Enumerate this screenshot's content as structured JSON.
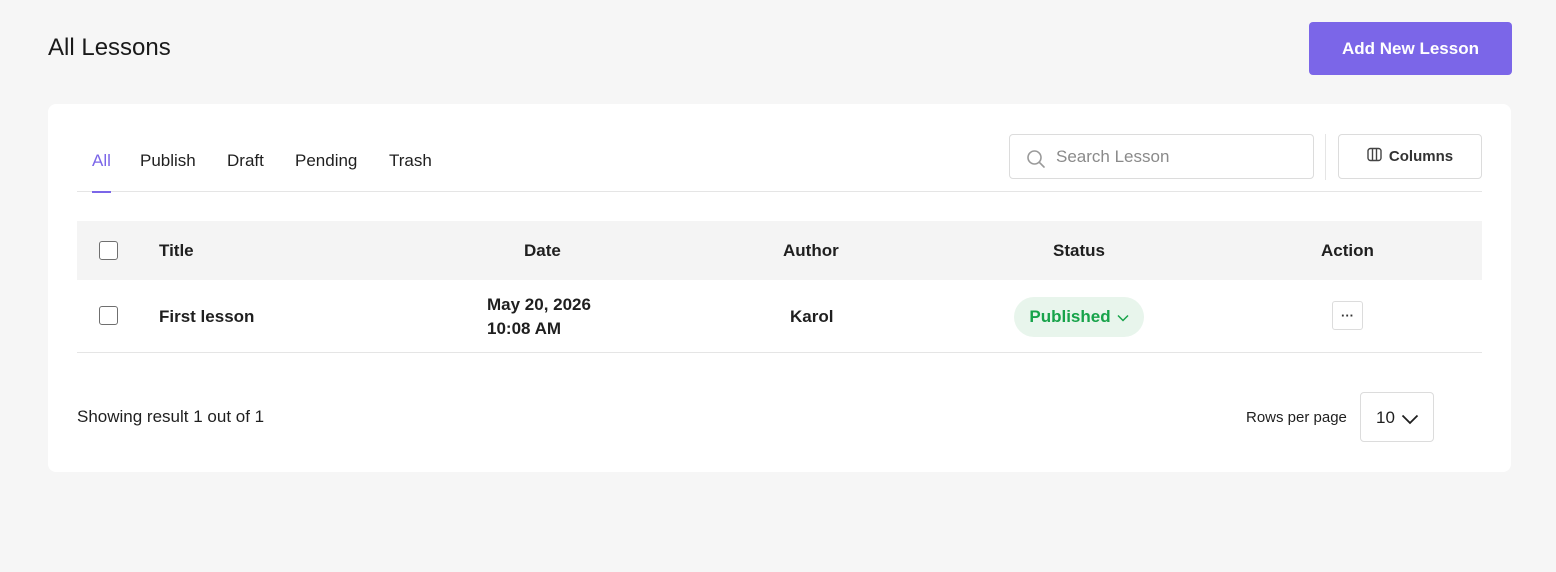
{
  "header": {
    "title": "All Lessons",
    "add_button_label": "Add New Lesson"
  },
  "tabs": [
    {
      "label": "All",
      "active": true
    },
    {
      "label": "Publish",
      "active": false
    },
    {
      "label": "Draft",
      "active": false
    },
    {
      "label": "Pending",
      "active": false
    },
    {
      "label": "Trash",
      "active": false
    }
  ],
  "search": {
    "placeholder": "Search Lesson",
    "value": ""
  },
  "columns_button_label": "Columns",
  "table": {
    "headers": {
      "title": "Title",
      "date": "Date",
      "author": "Author",
      "status": "Status",
      "action": "Action"
    },
    "rows": [
      {
        "title": "First lesson",
        "date_line1": "May 20, 2026",
        "date_line2": "10:08 AM",
        "author": "Karol",
        "status": "Published",
        "action_label": "···"
      }
    ]
  },
  "footer": {
    "showing_text": "Showing result 1 out of 1",
    "rows_per_page_label": "Rows per page",
    "rows_per_page_value": "10"
  },
  "colors": {
    "accent": "#7b66e8",
    "status_published_text": "#17a34a",
    "status_published_bg": "#e8f5ec",
    "page_bg": "#f6f6f6"
  },
  "icons": {
    "search": "search-icon",
    "columns": "columns-icon",
    "status_dropdown": "chevron-down-icon",
    "rows_dropdown": "chevron-down-icon"
  }
}
